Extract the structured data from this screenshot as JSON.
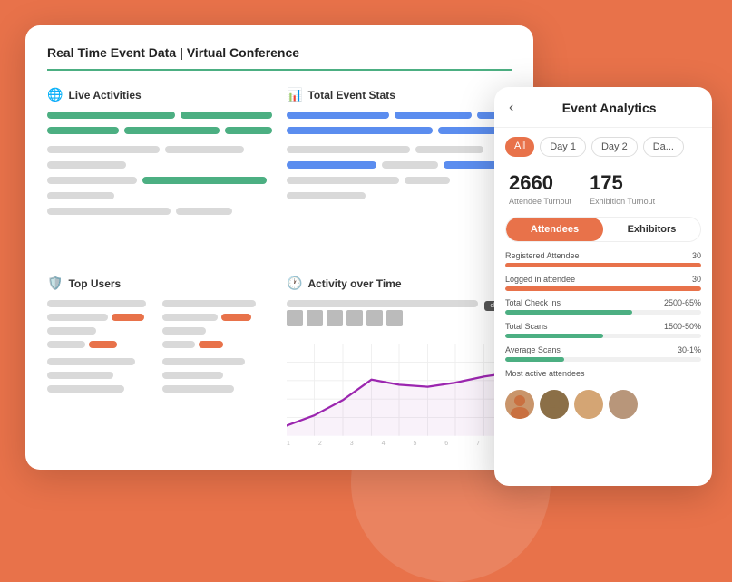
{
  "background": "#e8724a",
  "main_card": {
    "title": "Real Time Event Data | Virtual Conference",
    "sections": {
      "live_activities": {
        "label": "Live Activities",
        "icon": "🌐"
      },
      "total_event_stats": {
        "label": "Total Event Stats",
        "icon": "📊"
      },
      "top_users": {
        "label": "Top Users",
        "icon": "🛡️"
      },
      "activity_over_time": {
        "label": "Activity over Time",
        "icon": "🕐"
      }
    }
  },
  "analytics_panel": {
    "title": "Event Analytics",
    "back_icon": "‹",
    "tabs": [
      "All",
      "Day 1",
      "Day 2",
      "Da..."
    ],
    "stats": [
      {
        "number": "2660",
        "label": "Attendee Turnout"
      },
      {
        "number": "175",
        "label": "Exhibition Turnout"
      }
    ],
    "toggles": [
      "Attendees",
      "Exhibitors"
    ],
    "metrics": [
      {
        "label": "Registered Attendee",
        "value": "30",
        "fill_color": "#e8724a",
        "fill_pct": 100
      },
      {
        "label": "Logged in attendee",
        "value": "30",
        "fill_color": "#e8724a",
        "fill_pct": 100
      },
      {
        "label": "Total Check ins",
        "value": "2500-65%",
        "fill_color": "#4CAF82",
        "fill_pct": 65
      },
      {
        "label": "Total Scans",
        "value": "1500-50%",
        "fill_color": "#4CAF82",
        "fill_pct": 50
      },
      {
        "label": "Average Scans",
        "value": "30-1%",
        "fill_color": "#4CAF82",
        "fill_pct": 30
      },
      {
        "label": "Most active attendees",
        "value": "",
        "fill_color": "",
        "fill_pct": 0
      }
    ],
    "avatars": [
      "👩",
      "👱",
      "👩‍🦱",
      "👩‍🦰"
    ]
  }
}
